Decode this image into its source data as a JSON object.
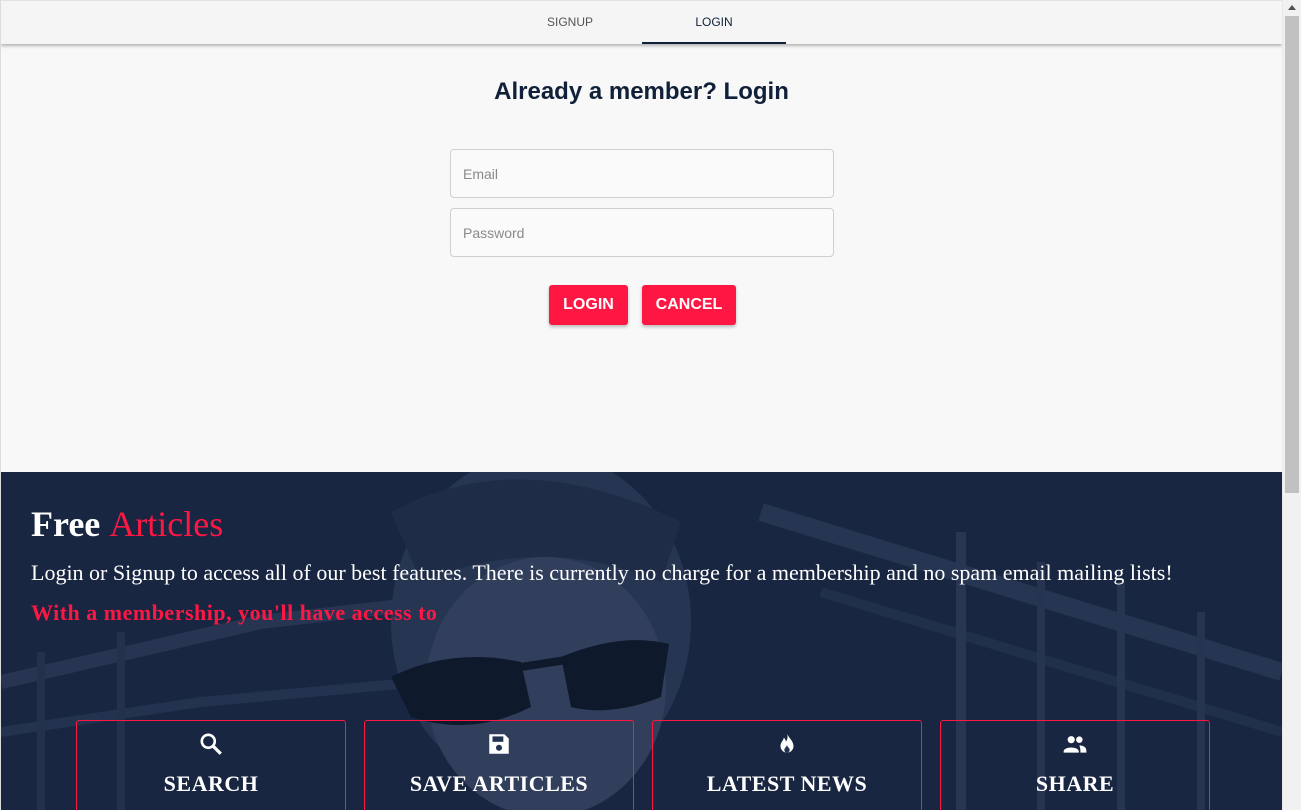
{
  "tabs": [
    {
      "label": "SIGNUP",
      "active": false
    },
    {
      "label": "LOGIN",
      "active": true
    }
  ],
  "login": {
    "title": "Already a member? Login",
    "email_placeholder": "Email",
    "password_placeholder": "Password",
    "login_label": "LOGIN",
    "cancel_label": "CANCEL"
  },
  "hero": {
    "title_white": "Free",
    "title_accent": "Articles",
    "text": "Login or Signup to access all of our best features. There is currently no charge for a membership and no spam email mailing lists!",
    "subtitle": "With a membership, you'll have access to"
  },
  "features": [
    {
      "icon": "search-icon",
      "title": "SEARCH"
    },
    {
      "icon": "save-icon",
      "title": "SAVE ARTICLES"
    },
    {
      "icon": "fire-icon",
      "title": "LATEST NEWS"
    },
    {
      "icon": "people-icon",
      "title": "SHARE"
    }
  ],
  "colors": {
    "accent": "#ff1744",
    "navy": "#102039",
    "background": "#f8f8f8"
  }
}
